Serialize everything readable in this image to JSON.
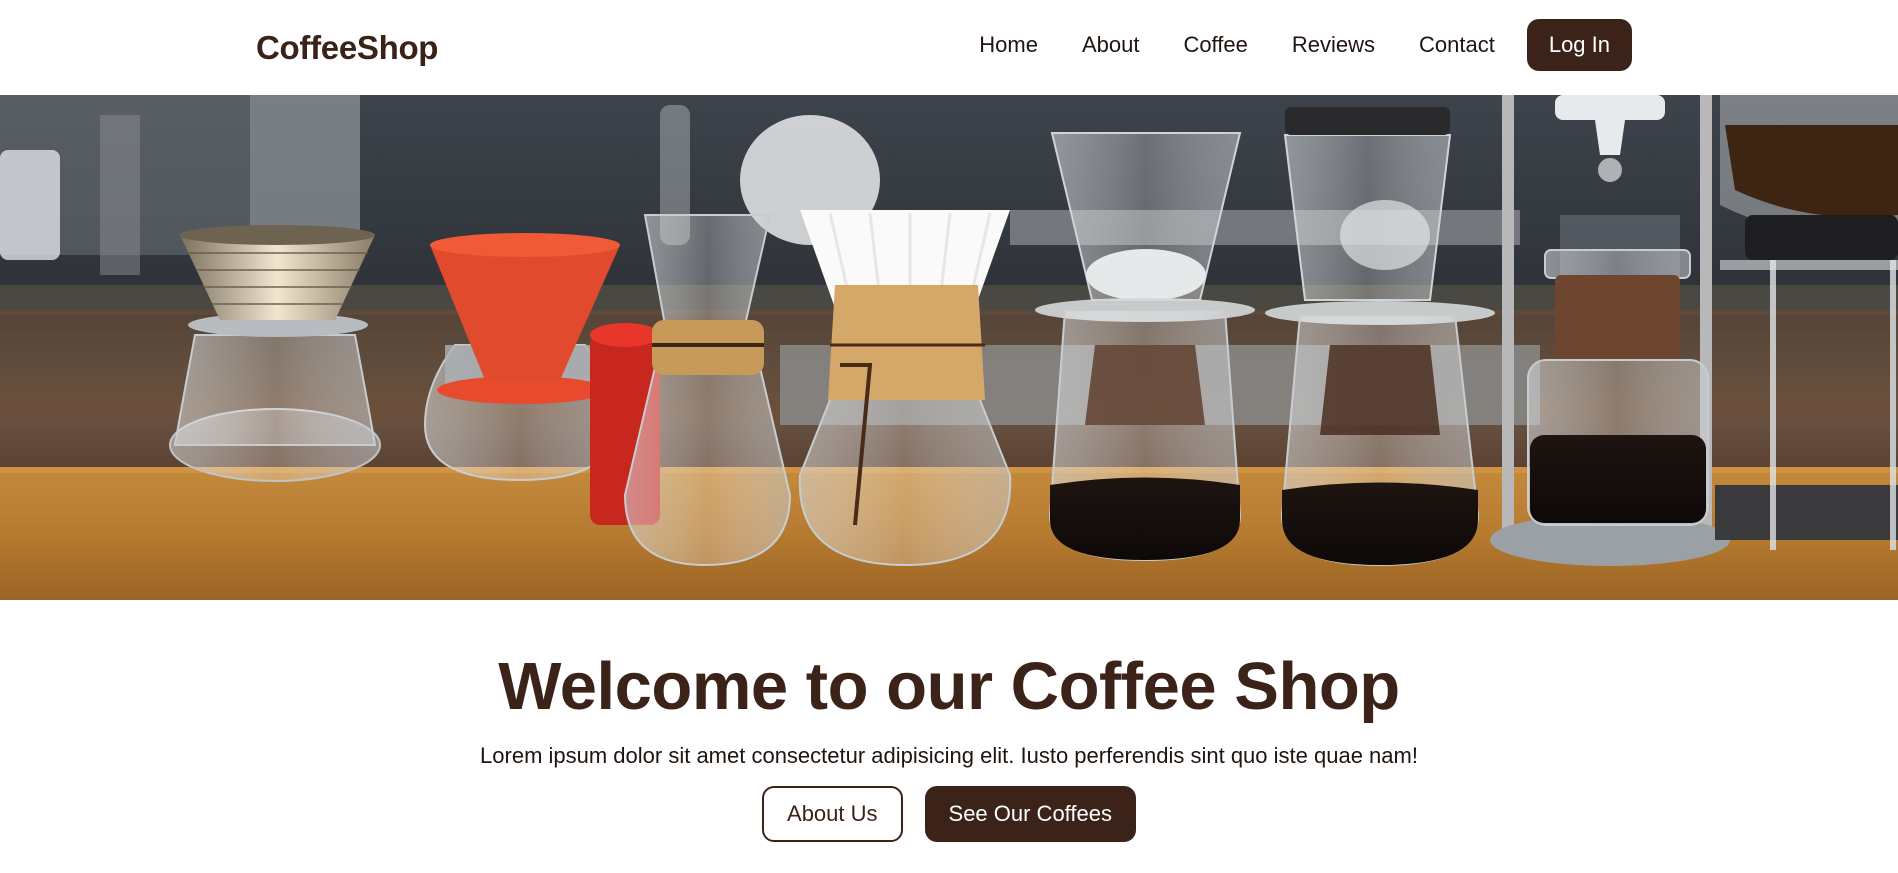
{
  "brand": "CoffeeShop",
  "nav": {
    "items": [
      "Home",
      "About",
      "Coffee",
      "Reviews",
      "Contact"
    ],
    "login_label": "Log In"
  },
  "hero": {
    "title": "Welcome to our Coffee Shop",
    "subtitle": "Lorem ipsum dolor sit amet consectetur adipisicing elit. Iusto perferendis sint quo iste quae nam!",
    "about_label": "About Us",
    "coffees_label": "See Our Coffees"
  },
  "colors": {
    "primary": "#3b2319",
    "text": "#1f1410",
    "background": "#ffffff"
  }
}
